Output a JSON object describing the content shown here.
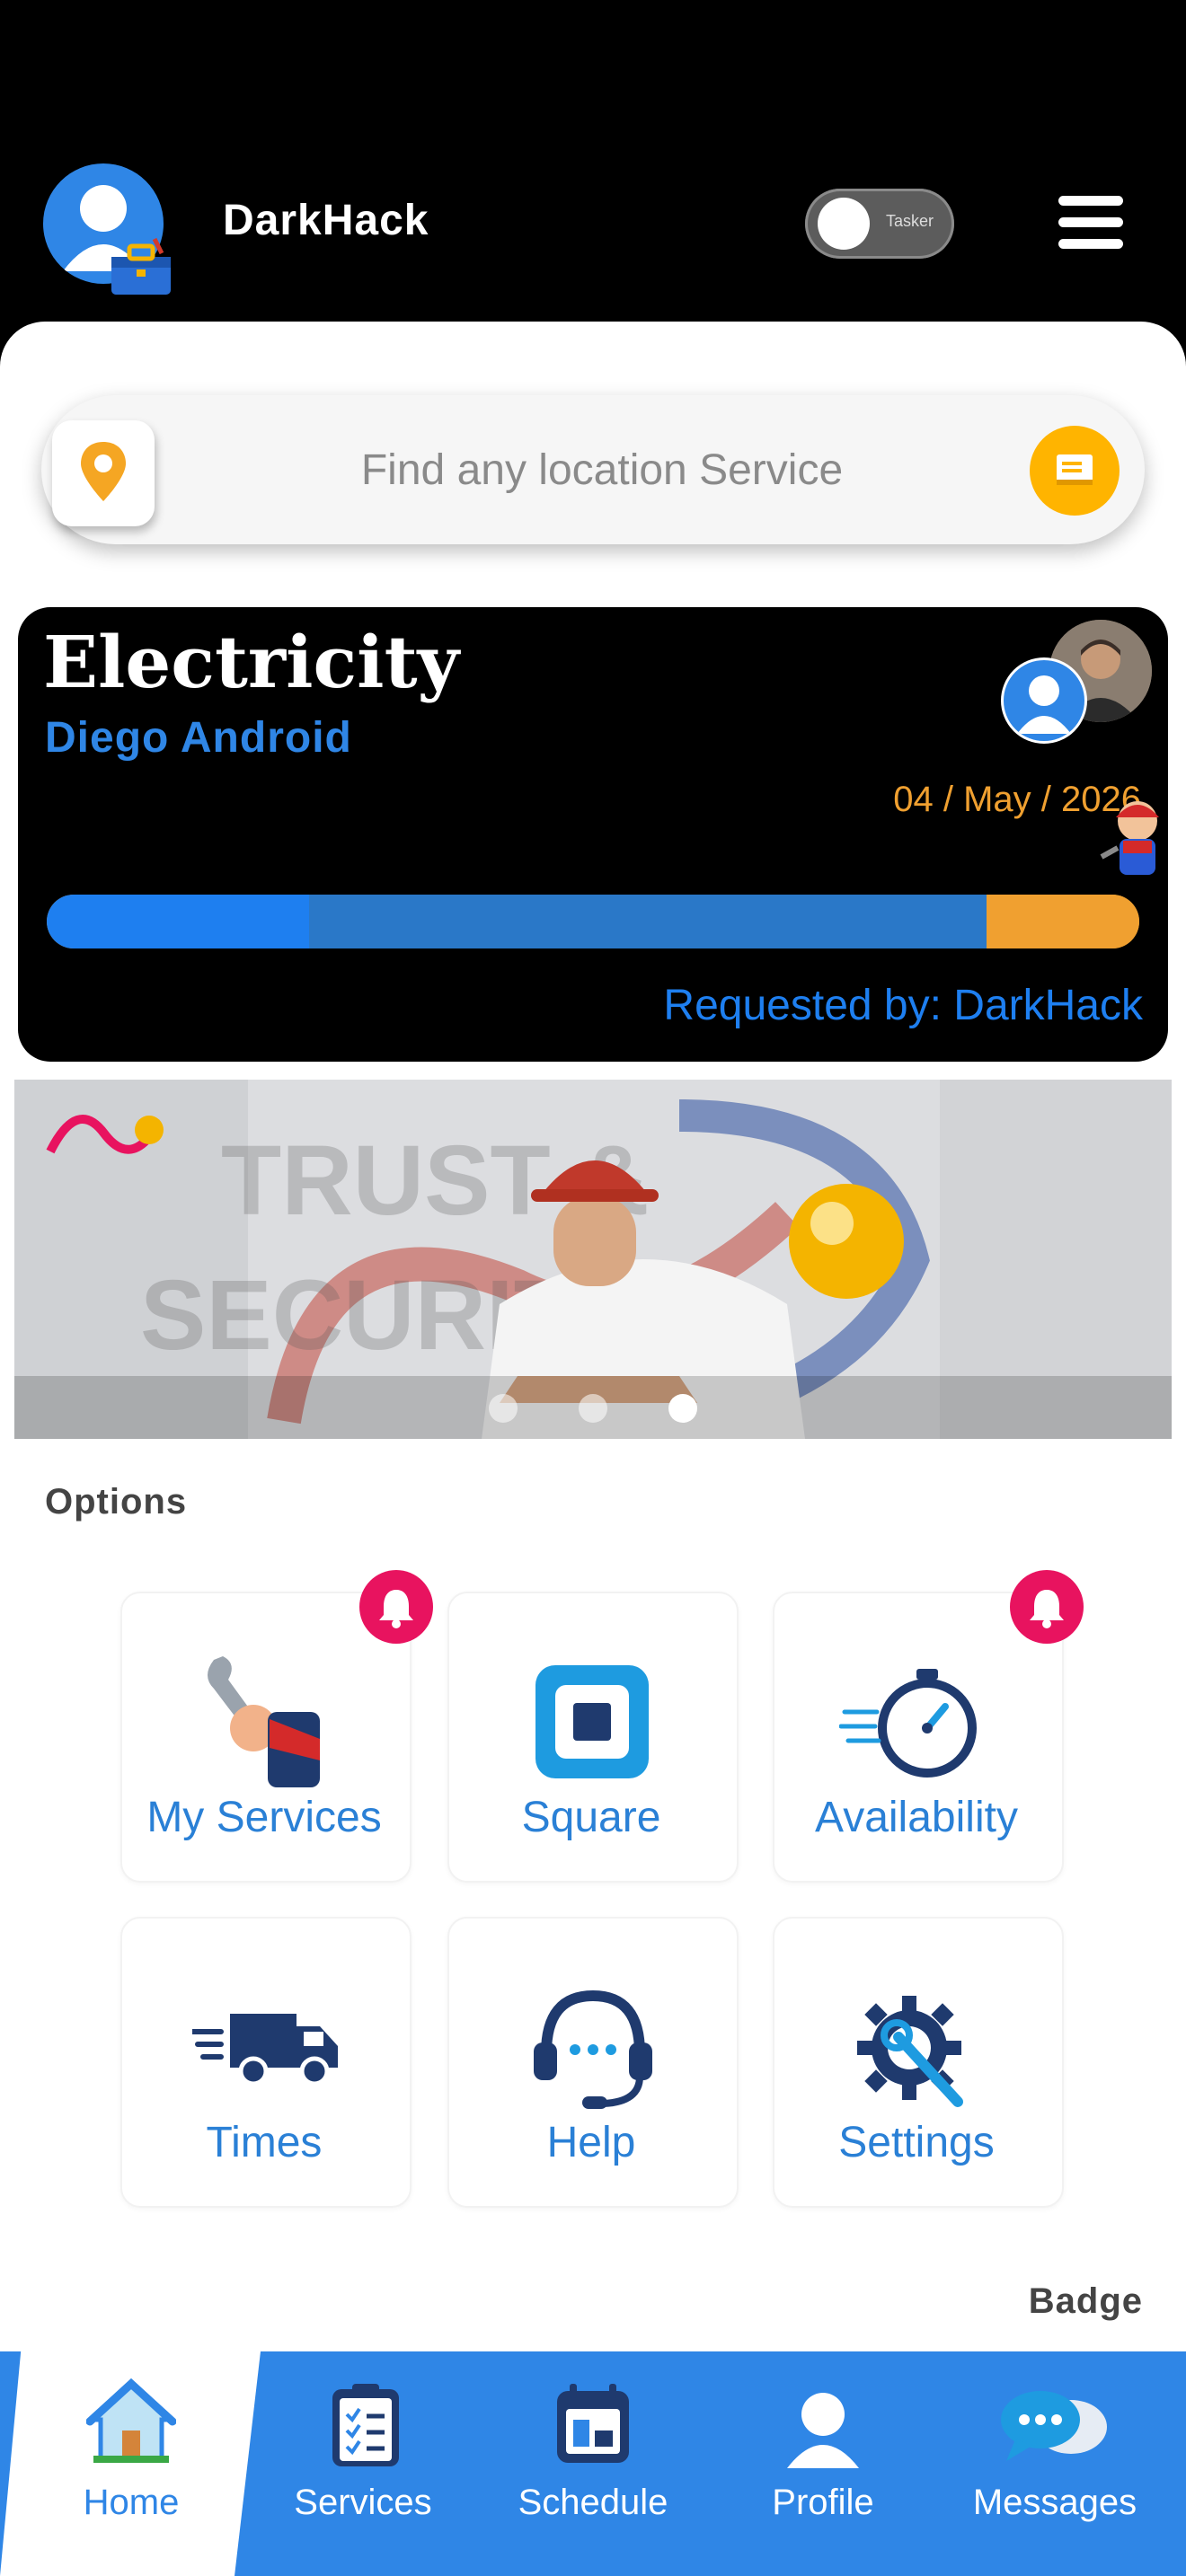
{
  "header": {
    "username": "DarkHack",
    "toggle_label": "Tasker"
  },
  "search": {
    "placeholder": "Find any location Service"
  },
  "service_card": {
    "title": "Electricity",
    "subtitle": "Diego Android",
    "date": "04 / May / 2026",
    "requested_by": "Requested by: DarkHack",
    "progress_fractions": [
      0.24,
      0.62,
      0.14
    ],
    "progress_colors": [
      "#1e7ff0",
      "#2a78c8",
      "#f0a030"
    ]
  },
  "banner": {
    "slide_count": 3,
    "active_slide": 3
  },
  "options": {
    "label": "Options",
    "items": [
      {
        "label": "My Services",
        "icon": "wrench-hand-icon",
        "has_bell": true
      },
      {
        "label": "Square",
        "icon": "square-icon",
        "has_bell": false
      },
      {
        "label": "Availability",
        "icon": "stopwatch-icon",
        "has_bell": true
      },
      {
        "label": "Times",
        "icon": "truck-icon",
        "has_bell": false
      },
      {
        "label": "Help",
        "icon": "headset-icon",
        "has_bell": false
      },
      {
        "label": "Settings",
        "icon": "gear-wrench-icon",
        "has_bell": false
      }
    ]
  },
  "badge_label": "Badge",
  "nav": {
    "items": [
      {
        "label": "Home",
        "active": true
      },
      {
        "label": "Services",
        "active": false
      },
      {
        "label": "Schedule",
        "active": false
      },
      {
        "label": "Profile",
        "active": false
      },
      {
        "label": "Messages",
        "active": false
      }
    ]
  },
  "colors": {
    "accent": "#2f86e6",
    "orange": "#f0a030",
    "bell": "#e8135f",
    "navy": "#1f3a6e"
  }
}
